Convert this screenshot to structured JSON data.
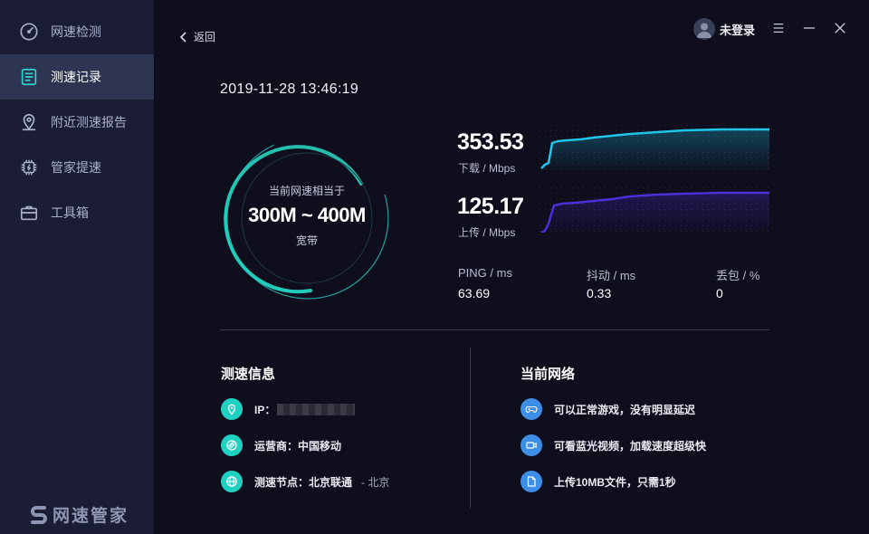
{
  "sidebar": {
    "items": [
      {
        "label": "网速检测",
        "icon": "speedometer-icon"
      },
      {
        "label": "测速记录",
        "icon": "document-icon",
        "active": true
      },
      {
        "label": "附近测速报告",
        "icon": "location-pin-icon"
      },
      {
        "label": "管家提速",
        "icon": "chip-icon"
      },
      {
        "label": "工具箱",
        "icon": "toolbox-icon"
      }
    ],
    "brand": "网速管家"
  },
  "header": {
    "back_label": "返回",
    "user_label": "未登录"
  },
  "record": {
    "datetime": "2019-11-28 13:46:19"
  },
  "gauge": {
    "caption": "当前网速相当于",
    "value": "300M ~ 400M",
    "unit": "宽带"
  },
  "download": {
    "value": "353.53",
    "label": "下载 / Mbps",
    "color": "#1fc6e8"
  },
  "upload": {
    "value": "125.17",
    "label": "上传 / Mbps",
    "color": "#4b2fd9"
  },
  "stats": [
    {
      "label": "PING / ms",
      "value": "63.69"
    },
    {
      "label": "抖动 / ms",
      "value": "0.33"
    },
    {
      "label": "丢包 / %",
      "value": "0"
    }
  ],
  "speed_info": {
    "title": "测速信息",
    "ip_label": "IP：",
    "isp": "运营商：中国移动",
    "node": "测速节点：北京联通",
    "node_region": "- 北京"
  },
  "network": {
    "title": "当前网络",
    "items": [
      {
        "text": "可以正常游戏，没有明显延迟",
        "icon": "gamepad-icon"
      },
      {
        "text": "可看蓝光视频，加载速度超级快",
        "icon": "video-camera-icon"
      },
      {
        "text": "上传10MB文件，只需1秒",
        "icon": "file-icon"
      }
    ]
  }
}
